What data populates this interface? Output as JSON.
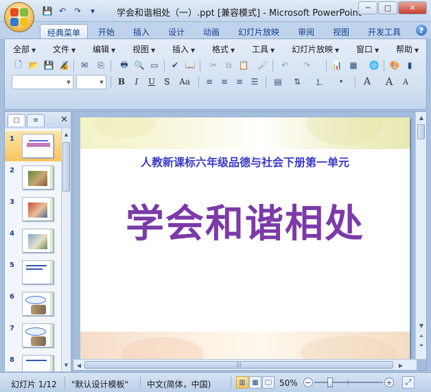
{
  "window": {
    "title": "学会和谐相处（一）.ppt [兼容模式] - Microsoft PowerPoint",
    "minimize": "─",
    "maximize": "□",
    "close": "✕"
  },
  "qat": {
    "save": "💾",
    "undo": "↶",
    "redo": "↷",
    "more": "▾"
  },
  "tabs": [
    {
      "label": "经典菜单"
    },
    {
      "label": "开始"
    },
    {
      "label": "插入"
    },
    {
      "label": "设计"
    },
    {
      "label": "动画"
    },
    {
      "label": "幻灯片放映"
    },
    {
      "label": "审阅"
    },
    {
      "label": "视图"
    },
    {
      "label": "开发工具"
    }
  ],
  "help": "?",
  "menu": [
    {
      "label": "全部"
    },
    {
      "label": "文件"
    },
    {
      "label": "编辑"
    },
    {
      "label": "视图"
    },
    {
      "label": "插入"
    },
    {
      "label": "格式"
    },
    {
      "label": "工具"
    },
    {
      "label": "幻灯片放映"
    },
    {
      "label": "窗口"
    },
    {
      "label": "帮助"
    }
  ],
  "format": {
    "bold": "B",
    "italic": "I",
    "underline": "U",
    "shadow": "S",
    "case": "Aa",
    "grow": "A",
    "shrink": "A"
  },
  "panel": {
    "tab_slides": "▢",
    "tab_outline": "≡",
    "close": "✕"
  },
  "thumbnails": [
    {
      "num": "1"
    },
    {
      "num": "2"
    },
    {
      "num": "3"
    },
    {
      "num": "4"
    },
    {
      "num": "5"
    },
    {
      "num": "6"
    },
    {
      "num": "7"
    },
    {
      "num": "8"
    }
  ],
  "slide": {
    "subtitle": "人教新课标六年级品德与社会下册第一单元",
    "title": "学会和谐相处"
  },
  "status": {
    "slide_info": "幻灯片 1/12",
    "theme": "\"默认设计模板\"",
    "language": "中文(简体，中国)",
    "zoom": "50%",
    "zoom_out": "−",
    "zoom_in": "+"
  },
  "colors": {
    "title_purple": "#7b3aa8",
    "subtitle_blue": "#3b3bc8",
    "ribbon_blue": "#d2e0f1",
    "selected_orange": "#f7c45a"
  }
}
